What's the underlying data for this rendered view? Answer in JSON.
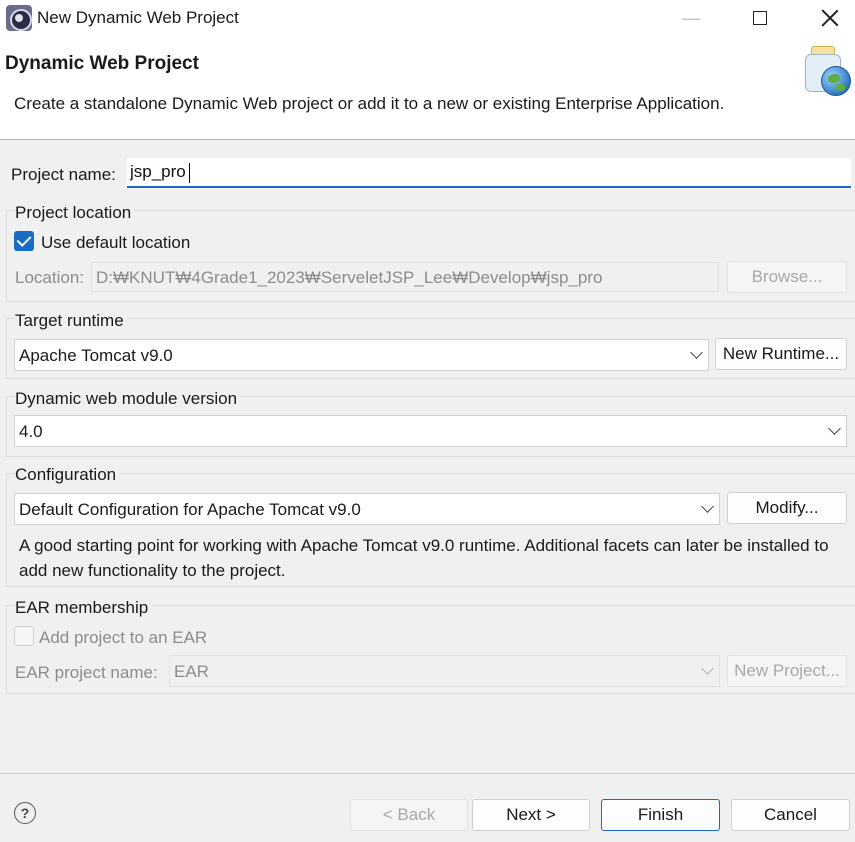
{
  "window": {
    "title": "New Dynamic Web Project",
    "minimize": "—"
  },
  "banner": {
    "title": "Dynamic Web Project",
    "description": "Create a standalone Dynamic Web project or add it to a new or existing Enterprise Application."
  },
  "project": {
    "name_label": "Project name:",
    "name_value": "jsp_pro"
  },
  "location": {
    "group_label": "Project location",
    "use_default_label": "Use default location",
    "use_default_checked": true,
    "location_label": "Location:",
    "location_value": "D:₩KNUT₩4Grade1_2023₩ServeletJSP_Lee₩Develop₩jsp_pro",
    "browse_label": "Browse..."
  },
  "runtime": {
    "group_label": "Target runtime",
    "selected": "Apache Tomcat v9.0",
    "new_runtime_label": "New Runtime..."
  },
  "module_version": {
    "group_label": "Dynamic web module version",
    "selected": "4.0"
  },
  "configuration": {
    "group_label": "Configuration",
    "selected": "Default Configuration for Apache Tomcat v9.0",
    "modify_label": "Modify...",
    "description": "A good starting point for working with Apache Tomcat v9.0 runtime. Additional facets can later be installed to add new functionality to the project."
  },
  "ear": {
    "group_label": "EAR membership",
    "add_label": "Add project to an EAR",
    "add_checked": false,
    "project_name_label": "EAR project name:",
    "project_name_value": "EAR",
    "new_project_label": "New Project..."
  },
  "footer": {
    "help_glyph": "?",
    "back_label": "< Back",
    "next_label": "Next >",
    "finish_label": "Finish",
    "cancel_label": "Cancel"
  },
  "colors": {
    "accent": "#1a6bc2",
    "dialog_bg": "#f0f0f0",
    "disabled_text": "#8c8c8c"
  }
}
